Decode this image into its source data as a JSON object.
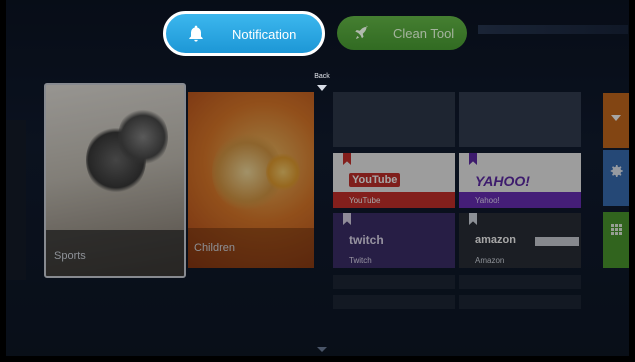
{
  "top_bar": {
    "notification_label": "Notification",
    "clean_tool_label": "Clean Tool",
    "back_label": "Back"
  },
  "tiles": {
    "sports_label": "Sports",
    "children_label": "Children"
  },
  "apps": [
    {
      "name": "YouTube",
      "logo": "YouTube",
      "color": "#c4302b"
    },
    {
      "name": "Yahoo!",
      "logo": "YAHOO!",
      "color": "#5f2aa8"
    },
    {
      "name": "Twitch",
      "logo": "twitch",
      "color": "#6441a5"
    },
    {
      "name": "Amazon",
      "logo": "amazon",
      "color": "#232f3e"
    }
  ],
  "colors": {
    "notification": "#2aa8e3",
    "clean_tool": "#4c9a2f",
    "settings_tile": "#3a6fb5",
    "apps_tile": "#4c9a2f",
    "top_right_tile": "#c86a1e"
  },
  "icons": {
    "notification": "bell-icon",
    "clean_tool": "rocket-icon",
    "settings": "gear-icon",
    "apps": "grid-icon"
  }
}
